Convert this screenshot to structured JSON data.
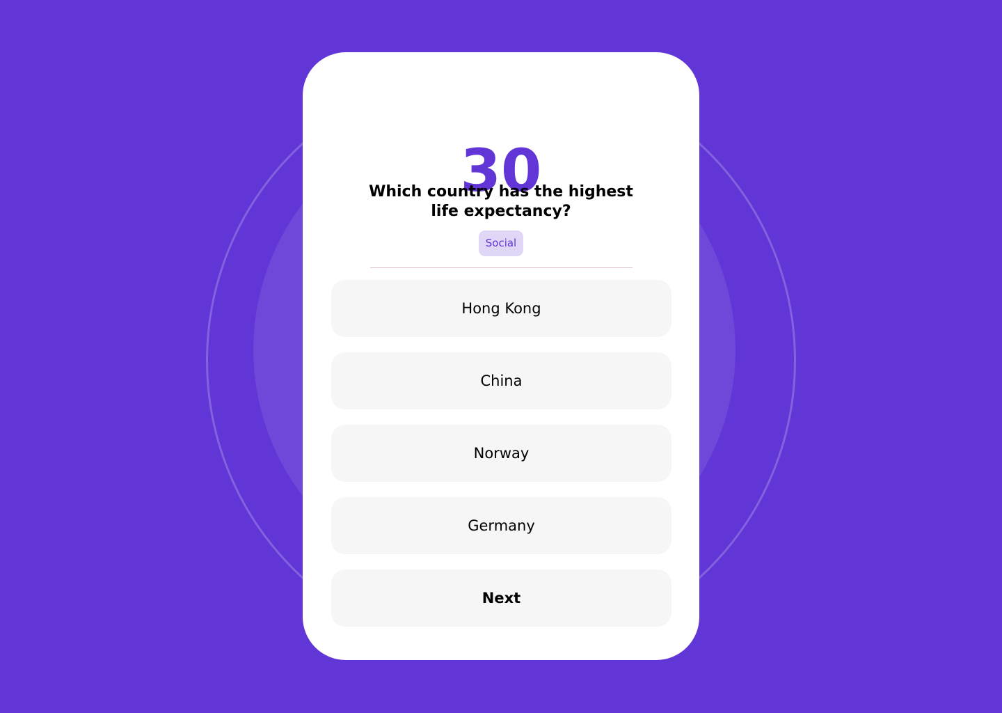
{
  "colors": {
    "background": "#6135d6",
    "accent": "#6135d6",
    "card": "#ffffff",
    "option_bg": "#f6f6f6",
    "tag_bg": "#e0d7f7"
  },
  "quiz": {
    "timer": "30",
    "question": "Which country has the highest life expectancy?",
    "category": "Social",
    "options": [
      {
        "label": "Hong Kong"
      },
      {
        "label": "China"
      },
      {
        "label": "Norway"
      },
      {
        "label": "Germany"
      }
    ],
    "next_label": "Next"
  }
}
